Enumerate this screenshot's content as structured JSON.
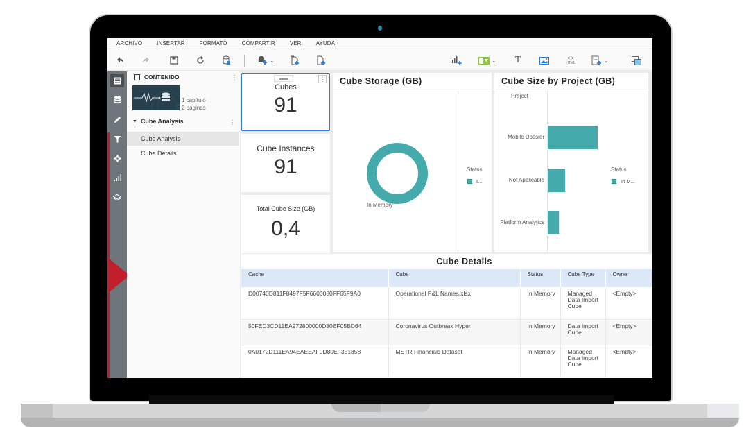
{
  "menu": [
    "ARCHIVO",
    "INSERTAR",
    "FORMATO",
    "COMPARTIR",
    "VER",
    "AYUDA"
  ],
  "toolbar": {
    "left_icons": [
      "undo-icon",
      "redo-icon",
      "save-icon",
      "refresh-icon",
      "data-source-icon",
      "add-dataset-icon",
      "add-chapter-icon",
      "add-page-icon"
    ],
    "right_icons": [
      "insert-visualization-icon",
      "insert-filter-icon",
      "text-icon",
      "image-icon",
      "html-container-icon",
      "widgets-icon",
      "layers-icon"
    ],
    "html_label": "HTML",
    "text_glyph": "T"
  },
  "rail": [
    "table-of-contents-icon",
    "datasets-icon",
    "format-icon",
    "filter-icon",
    "settings-icon",
    "chart-icon",
    "layers-icon"
  ],
  "contents": {
    "title": "CONTENIDO",
    "meta_line1": "1 capítulo",
    "meta_line2": "2 páginas",
    "chapter": "Cube Analysis",
    "pages": [
      "Cube Analysis",
      "Cube Details"
    ],
    "selected_page": 0
  },
  "kpis": [
    {
      "label": "Cubes",
      "value": "91"
    },
    {
      "label": "Cube Instances",
      "value": "91"
    },
    {
      "label": "Total Cube Size (GB)",
      "value": "0,4"
    }
  ],
  "colors": {
    "teal": "#45aaab",
    "accent_blue": "#2a7de1",
    "brand_red": "#c21f2d",
    "header_blue": "#dce8f7"
  },
  "chart_data": [
    {
      "type": "pie",
      "title": "Cube Storage (GB)",
      "categories": [
        "In Memory"
      ],
      "values": [
        0.4
      ],
      "donut": true,
      "legend_title": "Status",
      "legend_items": [
        "I..."
      ],
      "legend_position": "right"
    },
    {
      "type": "bar",
      "orientation": "horizontal",
      "title": "Cube Size by Project (GB)",
      "ylabel": "Project",
      "categories": [
        "Mobile Dossier",
        "Not Applicable",
        "Platform Analytics"
      ],
      "series": [
        {
          "name": "In Memory",
          "values": [
            0.2,
            0.07,
            0.045
          ]
        }
      ],
      "legend_title": "Status",
      "legend_items": [
        "In M..."
      ],
      "legend_position": "right"
    }
  ],
  "table": {
    "title": "Cube Details",
    "columns": [
      "Cache",
      "Cube",
      "Status",
      "Cube Type",
      "Owner"
    ],
    "rows": [
      [
        "D00740D811F8497F5F6600080FF65F9A0",
        "Operational P&L Names.xlsx",
        "In Memory",
        "Managed Data Import Cube",
        "<Empty>"
      ],
      [
        "50FED3CD11EA972800000D80EF05BD64",
        "Coronavirus Outbreak Hyper",
        "In Memory",
        "Data Import Cube",
        "<Empty>"
      ],
      [
        "0A0172D111EA94EAEEAF0D80EF351858",
        "MSTR Financials Dataset",
        "In Memory",
        "Managed Data Import Cube",
        "<Empty>"
      ]
    ]
  }
}
